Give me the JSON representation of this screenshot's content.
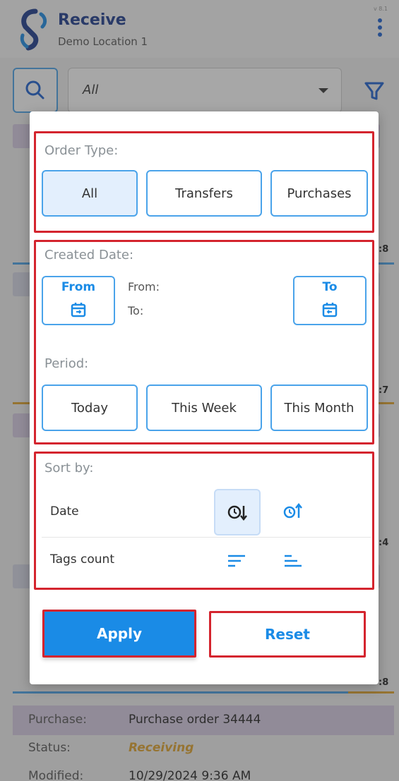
{
  "header": {
    "title": "Receive",
    "subtitle": "Demo Location 1",
    "version": "v 8.1"
  },
  "toolbar": {
    "select_value": "All"
  },
  "background": {
    "counts": [
      ":8",
      ":7",
      ":4",
      ":8"
    ],
    "card": {
      "purchase_label": "Purchase:",
      "purchase_value": "Purchase order 34444",
      "status_label": "Status:",
      "status_value": "Receiving",
      "modified_label": "Modified:",
      "modified_value": "10/29/2024  9:36 AM"
    }
  },
  "filter": {
    "order_type": {
      "title": "Order Type:",
      "options": [
        "All",
        "Transfers",
        "Purchases"
      ],
      "selected": "All"
    },
    "created_date": {
      "title": "Created Date:",
      "from_button": "From",
      "to_button": "To",
      "from_label": "From:",
      "to_label": "To:"
    },
    "period": {
      "title": "Period:",
      "options": [
        "Today",
        "This Week",
        "This Month"
      ]
    },
    "sort_by": {
      "title": "Sort by:",
      "rows": [
        {
          "label": "Date"
        },
        {
          "label": "Tags count"
        }
      ]
    },
    "apply_label": "Apply",
    "reset_label": "Reset"
  },
  "colors": {
    "accent": "#1a8be6",
    "highlight_border": "#d4242e",
    "brand": "#1a3a8c"
  }
}
